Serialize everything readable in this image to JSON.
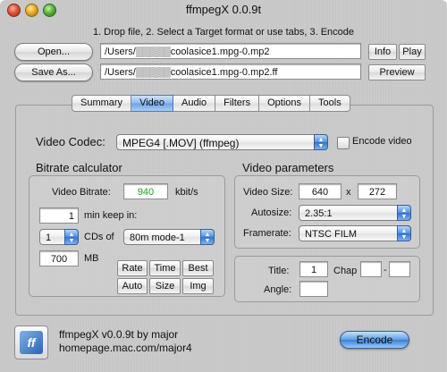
{
  "window": {
    "title": "ffmpegX 0.0.9t"
  },
  "instructions": "1. Drop file, 2. Select a Target format or use tabs, 3. Encode",
  "files": {
    "open_label": "Open...",
    "save_as_label": "Save As...",
    "source_path": "/Users/▒▒▒▒▒coolasice1.mpg-0.mp2",
    "target_path": "/Users/▒▒▒▒▒coolasice1.mpg-0.mp2.ff",
    "info_label": "Info",
    "play_label": "Play",
    "preview_label": "Preview"
  },
  "tabs": [
    {
      "label": "Summary",
      "active": false
    },
    {
      "label": "Video",
      "active": true
    },
    {
      "label": "Audio",
      "active": false
    },
    {
      "label": "Filters",
      "active": false
    },
    {
      "label": "Options",
      "active": false
    },
    {
      "label": "Tools",
      "active": false
    }
  ],
  "video": {
    "codec_label": "Video Codec:",
    "codec_value": "MPEG4 [.MOV] (ffmpeg)",
    "encode_video_label": "Encode video",
    "encode_video_checked": false
  },
  "bitrate": {
    "title": "Bitrate calculator",
    "video_bitrate_label": "Video Bitrate:",
    "video_bitrate_value": "940",
    "video_bitrate_color": "#21a121",
    "unit": "kbit/s",
    "min_value": "1",
    "min_label": "min keep in:",
    "cds_value": "1",
    "cds_label": "CDs of",
    "cd_type": "80m mode-1",
    "mb_value": "700",
    "mb_label": "MB",
    "buttons": [
      "Rate",
      "Time",
      "Best",
      "Auto",
      "Size",
      "Img"
    ]
  },
  "params": {
    "title": "Video parameters",
    "size_label": "Video Size:",
    "width": "640",
    "x_label": "x",
    "height": "272",
    "autosize_label": "Autosize:",
    "autosize_value": "2.35:1",
    "framerate_label": "Framerate:",
    "framerate_value": "NTSC FILM"
  },
  "dvd": {
    "title_label": "Title:",
    "title_value": "1",
    "chap_label": "Chap",
    "chap_from": "",
    "dash": "-",
    "chap_to": "",
    "angle_label": "Angle:",
    "angle_value": ""
  },
  "footer": {
    "logo_text": "ff",
    "version": "ffmpegX v0.0.9t by major",
    "homepage": "homepage.mac.com/major4",
    "encode_label": "Encode"
  }
}
